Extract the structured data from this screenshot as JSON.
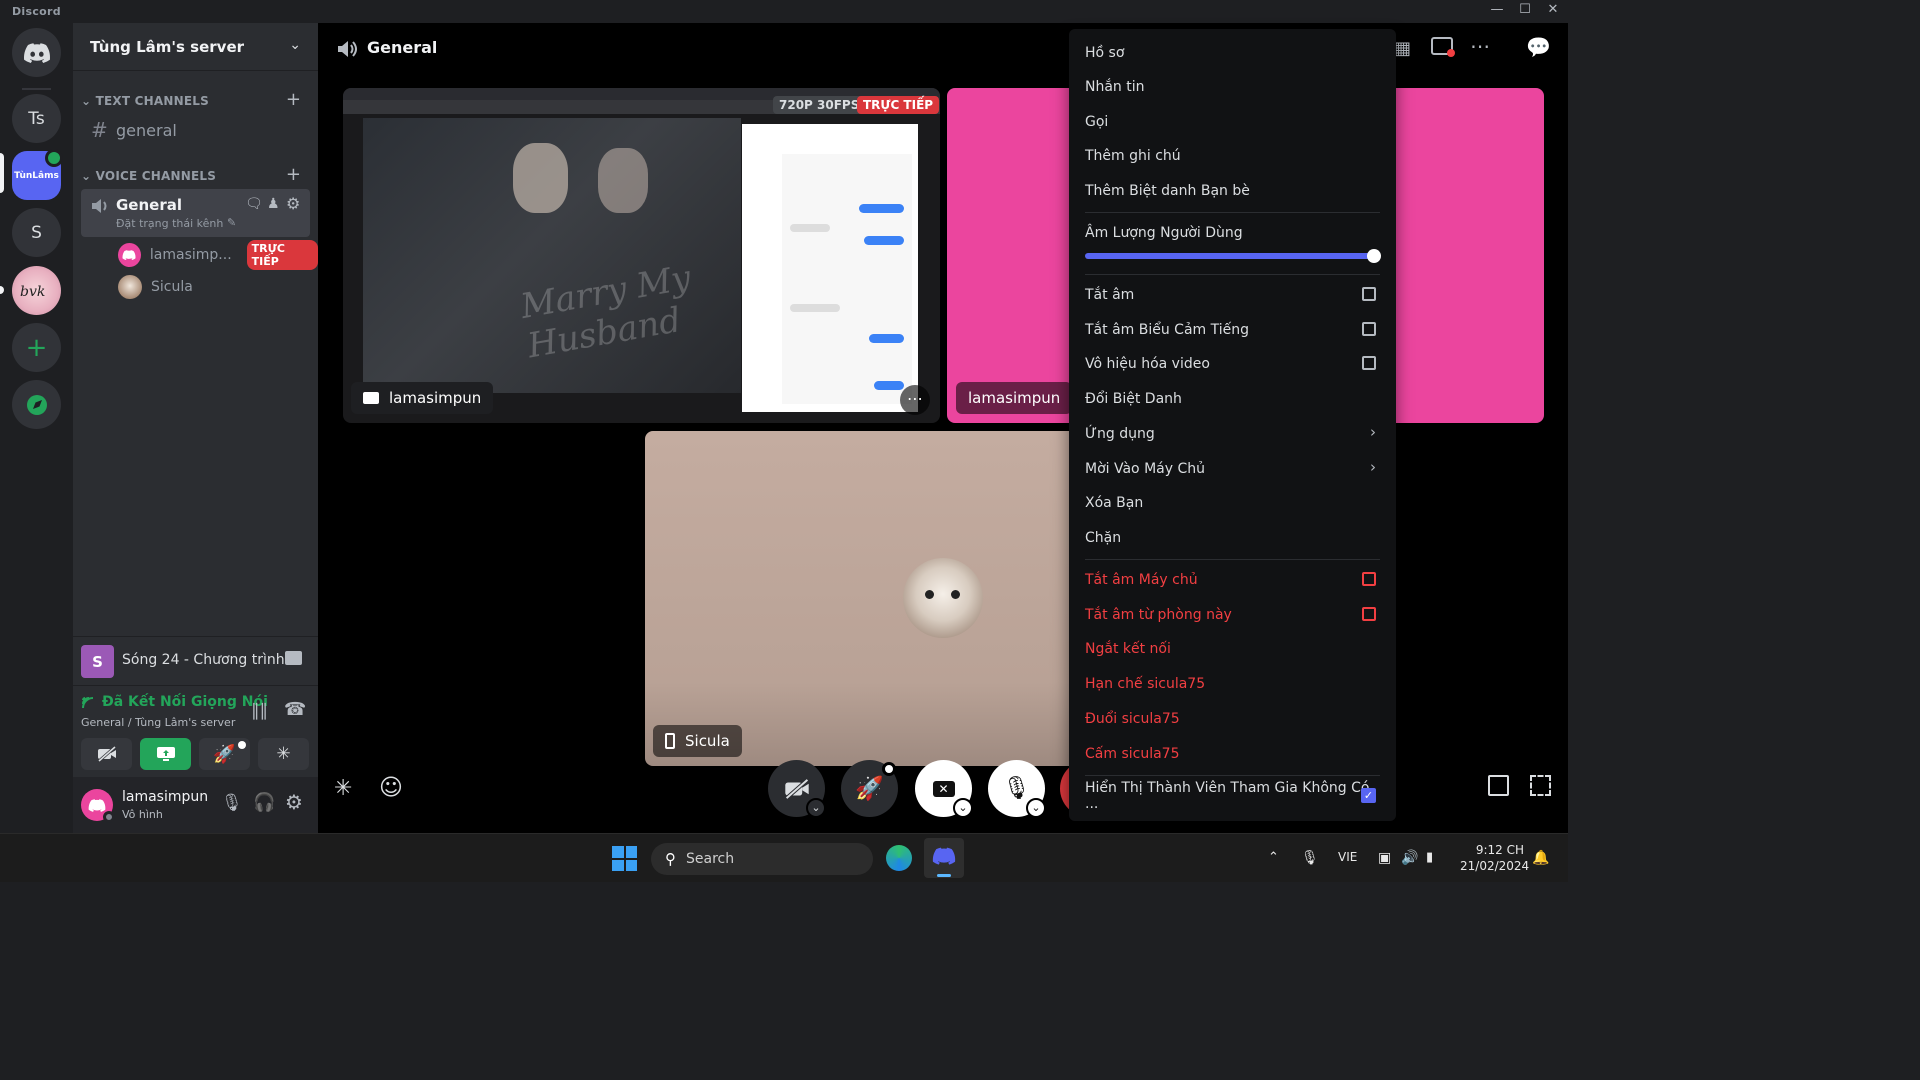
{
  "window": {
    "title": "Discord"
  },
  "servers": [
    {
      "label": "",
      "icon": "discord-home-icon"
    },
    {
      "label": "Ts"
    },
    {
      "label": "TùnLâms"
    },
    {
      "label": "S"
    },
    {
      "label": "",
      "icon": "server-avatar-image"
    },
    {
      "label": "+",
      "icon": "add-server-icon"
    },
    {
      "label": "",
      "icon": "explore-icon"
    }
  ],
  "sidebar": {
    "server_name": "Tùng Lâm's server",
    "text_category": "TEXT CHANNELS",
    "text_channels": [
      {
        "name": "general"
      }
    ],
    "voice_category": "VOICE CHANNELS",
    "voice_channel": {
      "name": "General",
      "status_placeholder": "Đặt trạng thái kênh"
    },
    "voice_users": [
      {
        "name": "lamasimp...",
        "badge": "TRỰC TIẾP"
      },
      {
        "name": "Sicula"
      }
    ],
    "activity": {
      "label": "Sóng 24 - Chương trình..."
    },
    "voice_status": {
      "title": "Đã Kết Nối Giọng Nói",
      "subtitle": "General / Tùng Lâm's server"
    },
    "user": {
      "name": "lamasimpun",
      "status": "Vô hình"
    }
  },
  "main": {
    "channel_title": "General",
    "stream_quality": "720P 30FPS",
    "stream_live": "TRỰC TIẾP",
    "stream_owner": "lamasimpun",
    "stream_watermark": "Marry My Husband",
    "pink_tile_user": "lamasimpun",
    "cam_tile_user": "Sicula"
  },
  "context_menu": {
    "items_top": [
      "Hồ sơ",
      "Nhắn tin",
      "Gọi",
      "Thêm ghi chú",
      "Thêm Biệt danh Bạn bè"
    ],
    "volume_label": "Âm Lượng Người Dùng",
    "volume_value": 100,
    "items_mid": [
      {
        "label": "Tắt âm",
        "type": "checkbox",
        "checked": false
      },
      {
        "label": "Tắt âm Biểu Cảm Tiếng",
        "type": "checkbox",
        "checked": false
      },
      {
        "label": "Vô hiệu hóa video",
        "type": "checkbox",
        "checked": false
      },
      {
        "label": "Đổi Biệt Danh",
        "type": "plain"
      },
      {
        "label": "Ứng dụng",
        "type": "submenu"
      },
      {
        "label": "Mời Vào Máy Chủ",
        "type": "submenu"
      },
      {
        "label": "Xóa Bạn",
        "type": "plain"
      },
      {
        "label": "Chặn",
        "type": "plain"
      }
    ],
    "items_danger": [
      {
        "label": "Tắt âm Máy chủ",
        "type": "checkbox",
        "checked": false
      },
      {
        "label": "Tắt âm từ phòng này",
        "type": "checkbox",
        "checked": false
      },
      {
        "label": "Ngắt kết nối",
        "type": "plain"
      },
      {
        "label": "Hạn chế sicula75",
        "type": "plain"
      },
      {
        "label": "Đuổi sicula75",
        "type": "plain"
      },
      {
        "label": "Cấm sicula75",
        "type": "plain"
      }
    ],
    "bottom_item": {
      "label": "Hiển Thị Thành Viên Tham Gia Không Có ...",
      "checked": true
    }
  },
  "taskbar": {
    "search_placeholder": "Search",
    "language": "VIE",
    "time": "9:12 CH",
    "date": "21/02/2024"
  },
  "colors": {
    "accent": "#5865f2",
    "danger": "#f23f42",
    "live": "#da373c",
    "connected": "#23a55a",
    "pink": "#eb459e"
  }
}
